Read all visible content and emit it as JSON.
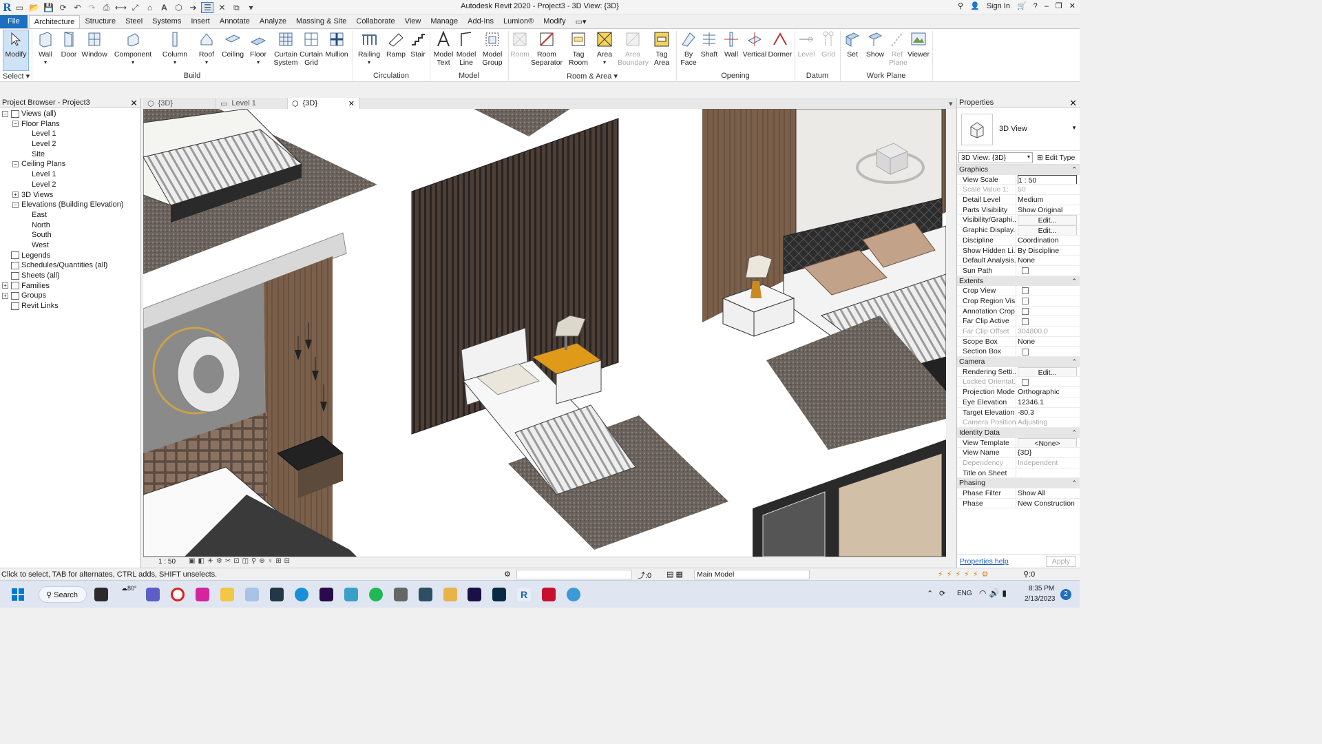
{
  "titlebar": {
    "title": "Autodesk Revit 2020 - Project3 - 3D View: {3D}",
    "sign_in": "Sign In"
  },
  "menu": {
    "tabs": [
      "File",
      "Architecture",
      "Structure",
      "Steel",
      "Systems",
      "Insert",
      "Annotate",
      "Analyze",
      "Massing & Site",
      "Collaborate",
      "View",
      "Manage",
      "Add-Ins",
      "Lumion®",
      "Modify"
    ]
  },
  "ribbon": {
    "modify": "Modify",
    "select": "Select",
    "build": {
      "label": "Build",
      "wall": "Wall",
      "door": "Door",
      "window": "Window",
      "component": "Component",
      "column": "Column",
      "roof": "Roof",
      "ceiling": "Ceiling",
      "floor": "Floor",
      "curtain_system": "Curtain System",
      "curtain_grid": "Curtain Grid",
      "mullion": "Mullion"
    },
    "circulation": {
      "label": "Circulation",
      "railing": "Railing",
      "ramp": "Ramp",
      "stair": "Stair"
    },
    "model": {
      "label": "Model",
      "model_text": "Model Text",
      "model_line": "Model Line",
      "model_group": "Model Group"
    },
    "room_area": {
      "label": "Room & Area",
      "room": "Room",
      "room_separator": "Room Separator",
      "tag_room": "Tag Room",
      "area": "Area",
      "area_boundary": "Area Boundary",
      "tag_area": "Tag Area"
    },
    "opening": {
      "label": "Opening",
      "by_face": "By Face",
      "shaft": "Shaft",
      "wall": "Wall",
      "vertical": "Vertical",
      "dormer": "Dormer"
    },
    "datum": {
      "label": "Datum",
      "level": "Level",
      "grid": "Grid"
    },
    "work_plane": {
      "label": "Work Plane",
      "set": "Set",
      "show": "Show",
      "ref_plane": "Ref Plane",
      "viewer": "Viewer"
    }
  },
  "project_browser": {
    "title": "Project Browser - Project3",
    "items": [
      {
        "label": "Views (all)",
        "level": 0,
        "tog": "−"
      },
      {
        "label": "Floor Plans",
        "level": 1,
        "tog": "−"
      },
      {
        "label": "Level 1",
        "level": 2
      },
      {
        "label": "Level 2",
        "level": 2
      },
      {
        "label": "Site",
        "level": 2
      },
      {
        "label": "Ceiling Plans",
        "level": 1,
        "tog": "−"
      },
      {
        "label": "Level 1",
        "level": 2
      },
      {
        "label": "Level 2",
        "level": 2
      },
      {
        "label": "3D Views",
        "level": 1,
        "tog": "+"
      },
      {
        "label": "Elevations (Building Elevation)",
        "level": 1,
        "tog": "−"
      },
      {
        "label": "East",
        "level": 2
      },
      {
        "label": "North",
        "level": 2
      },
      {
        "label": "South",
        "level": 2
      },
      {
        "label": "West",
        "level": 2
      },
      {
        "label": "Legends",
        "level": 0
      },
      {
        "label": "Schedules/Quantities (all)",
        "level": 0
      },
      {
        "label": "Sheets (all)",
        "level": 0
      },
      {
        "label": "Families",
        "level": 0,
        "tog": "+"
      },
      {
        "label": "Groups",
        "level": 0,
        "tog": "+"
      },
      {
        "label": "Revit Links",
        "level": 0
      }
    ]
  },
  "view_tabs": [
    "{3D}",
    "Level 1",
    "{3D}"
  ],
  "view_bar": {
    "scale": "1 : 50"
  },
  "properties": {
    "title": "Properties",
    "type_name": "3D View",
    "selector": "3D View: {3D}",
    "edit_type": "Edit Type",
    "groups": [
      {
        "name": "Graphics",
        "rows": [
          {
            "k": "View Scale",
            "v": "1 : 50",
            "box": true
          },
          {
            "k": "Scale Value    1:",
            "v": "50",
            "dis": true
          },
          {
            "k": "Detail Level",
            "v": "Medium"
          },
          {
            "k": "Parts Visibility",
            "v": "Show Original"
          },
          {
            "k": "Visibility/Graphi...",
            "v": "Edit...",
            "btn": true
          },
          {
            "k": "Graphic Display...",
            "v": "Edit...",
            "btn": true
          },
          {
            "k": "Discipline",
            "v": "Coordination"
          },
          {
            "k": "Show Hidden Li...",
            "v": "By Discipline"
          },
          {
            "k": "Default Analysis...",
            "v": "None"
          },
          {
            "k": "Sun Path",
            "v": "",
            "chk": true
          }
        ]
      },
      {
        "name": "Extents",
        "rows": [
          {
            "k": "Crop View",
            "v": "",
            "chk": true
          },
          {
            "k": "Crop Region Vis...",
            "v": "",
            "chk": true
          },
          {
            "k": "Annotation Crop",
            "v": "",
            "chk": true
          },
          {
            "k": "Far Clip Active",
            "v": "",
            "chk": true
          },
          {
            "k": "Far Clip Offset",
            "v": "304800.0",
            "dis": true
          },
          {
            "k": "Scope Box",
            "v": "None"
          },
          {
            "k": "Section Box",
            "v": "",
            "chk": true
          }
        ]
      },
      {
        "name": "Camera",
        "rows": [
          {
            "k": "Rendering Setti...",
            "v": "Edit...",
            "btn": true
          },
          {
            "k": "Locked Orientat...",
            "v": "",
            "chk": true,
            "dis": true
          },
          {
            "k": "Projection Mode",
            "v": "Orthographic"
          },
          {
            "k": "Eye Elevation",
            "v": "12346.1"
          },
          {
            "k": "Target Elevation",
            "v": "-80.3"
          },
          {
            "k": "Camera Position",
            "v": "Adjusting",
            "dis": true
          }
        ]
      },
      {
        "name": "Identity Data",
        "rows": [
          {
            "k": "View Template",
            "v": "<None>",
            "btn": true
          },
          {
            "k": "View Name",
            "v": "{3D}"
          },
          {
            "k": "Dependency",
            "v": "Independent",
            "dis": true
          },
          {
            "k": "Title on Sheet",
            "v": ""
          }
        ]
      },
      {
        "name": "Phasing",
        "rows": [
          {
            "k": "Phase Filter",
            "v": "Show All"
          },
          {
            "k": "Phase",
            "v": "New Construction"
          }
        ]
      }
    ],
    "help": "Properties help",
    "apply": "Apply"
  },
  "status": {
    "hint": "Click to select, TAB for alternates, CTRL adds, SHIFT unselects.",
    "count": ":0",
    "model": "Main Model",
    "filter": ":0"
  },
  "taskbar": {
    "search": "Search",
    "temp": "80°",
    "lang": "ENG",
    "time": "8:35 PM",
    "date": "2/13/2023",
    "badge": "2"
  }
}
